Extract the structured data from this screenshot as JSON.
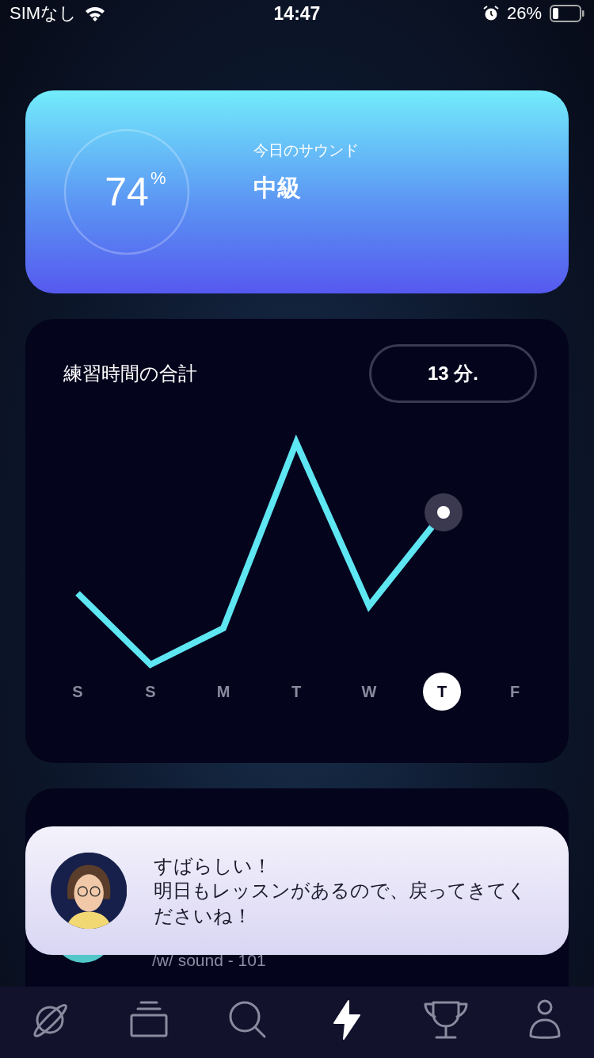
{
  "status_bar": {
    "carrier": "SIMなし",
    "time": "14:47",
    "battery": "26%"
  },
  "sound_card": {
    "percent": "74",
    "percent_sign": "%",
    "label": "今日のサウンド",
    "level_name": "中級"
  },
  "practice_card": {
    "title": "練習時間の合計",
    "total": "13 分.",
    "days": [
      {
        "label": "S",
        "selected": false
      },
      {
        "label": "S",
        "selected": false
      },
      {
        "label": "M",
        "selected": false
      },
      {
        "label": "T",
        "selected": false
      },
      {
        "label": "W",
        "selected": false
      },
      {
        "label": "T",
        "selected": true
      },
      {
        "label": "F",
        "selected": false
      }
    ]
  },
  "lesson_card": {
    "subtitle": "/w/ sound - 101"
  },
  "toast": {
    "lines": [
      "すばらしい！",
      "明日もレッスンがあるので、戻ってきてくださいね！"
    ]
  },
  "tab_bar": [
    {
      "kind": "planet",
      "selected": false
    },
    {
      "kind": "stack",
      "selected": false
    },
    {
      "kind": "search",
      "selected": false
    },
    {
      "kind": "bolt",
      "selected": true
    },
    {
      "kind": "trophy",
      "selected": false
    },
    {
      "kind": "user",
      "selected": false
    }
  ]
}
